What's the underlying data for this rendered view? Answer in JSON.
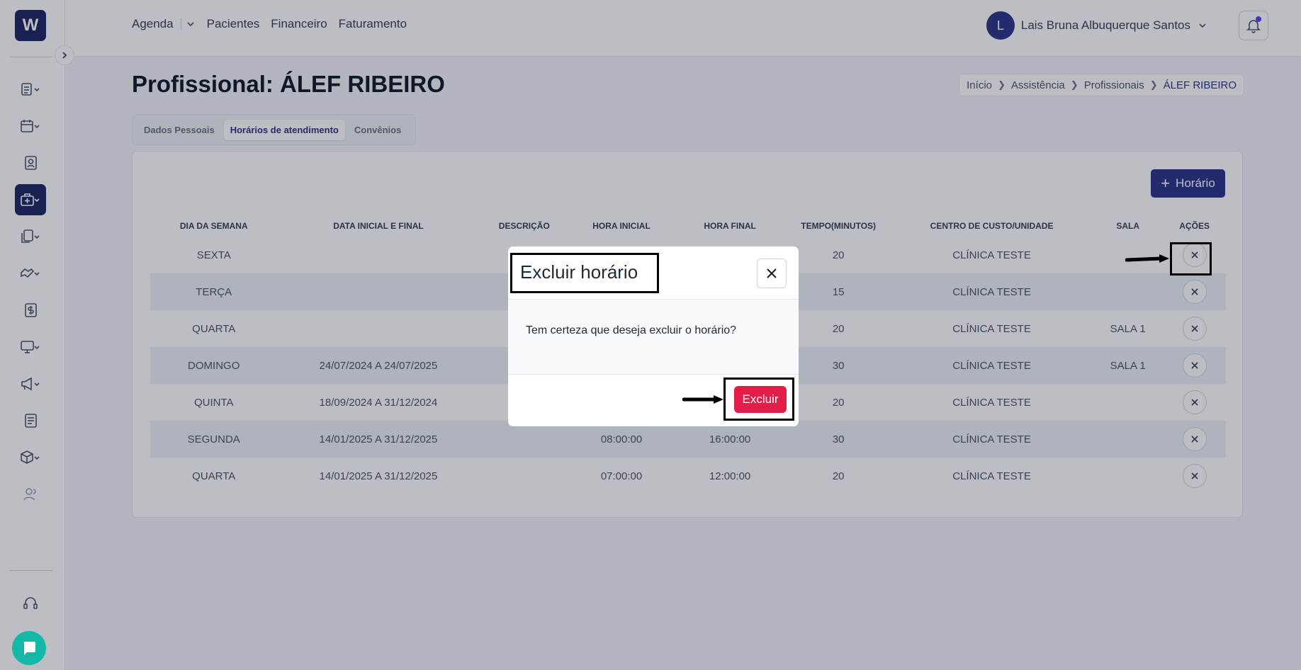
{
  "header": {
    "logo_text": "W",
    "nav": [
      {
        "label": "Agenda"
      },
      {
        "label": "Pacientes"
      },
      {
        "label": "Financeiro"
      },
      {
        "label": "Faturamento"
      }
    ],
    "user": {
      "initial": "L",
      "name": "Lais Bruna Albuquerque Santos"
    },
    "notification_dot_color": "#4f46e5"
  },
  "sidebar": {
    "items": [
      {
        "icon": "list-icon"
      },
      {
        "icon": "calendar-icon"
      },
      {
        "icon": "contact-icon"
      },
      {
        "icon": "medical-briefcase-icon",
        "active": true
      },
      {
        "icon": "documents-icon"
      },
      {
        "icon": "handshake-icon"
      },
      {
        "icon": "dollar-icon"
      },
      {
        "icon": "monitor-icon"
      },
      {
        "icon": "megaphone-icon"
      },
      {
        "icon": "reports-icon"
      },
      {
        "icon": "package-icon"
      },
      {
        "icon": "users-icon"
      }
    ],
    "support_icon": "headset-icon"
  },
  "page": {
    "title": "Profissional: ÁLEF RIBEIRO",
    "breadcrumb": [
      "Início",
      "Assistência",
      "Profissionais",
      "ÁLEF RIBEIRO"
    ],
    "tabs": [
      {
        "label": "Dados Pessoais",
        "active": false
      },
      {
        "label": "Horários de atendimento",
        "active": true
      },
      {
        "label": "Convênios",
        "active": false
      }
    ],
    "add_button": "Horário"
  },
  "table": {
    "columns": [
      "DIA DA SEMANA",
      "DATA INICIAL E FINAL",
      "DESCRIÇÃO",
      "HORA INICIAL",
      "HORA FINAL",
      "TEMPO(MINUTOS)",
      "CENTRO DE CUSTO/UNIDADE",
      "SALA",
      "AÇÕES"
    ],
    "rows": [
      {
        "dia": "SEXTA",
        "datas": "",
        "descricao": "",
        "hora_inicial": "",
        "hora_final": "",
        "tempo": "20",
        "centro": "CLÍNICA TESTE",
        "sala": ""
      },
      {
        "dia": "TERÇA",
        "datas": "",
        "descricao": "",
        "hora_inicial": "",
        "hora_final": "",
        "tempo": "15",
        "centro": "CLÍNICA TESTE",
        "sala": ""
      },
      {
        "dia": "QUARTA",
        "datas": "",
        "descricao": "",
        "hora_inicial": "",
        "hora_final": "",
        "tempo": "20",
        "centro": "CLÍNICA TESTE",
        "sala": "SALA 1"
      },
      {
        "dia": "DOMINGO",
        "datas": "24/07/2024 A 24/07/2025",
        "descricao": "",
        "hora_inicial": "",
        "hora_final": "",
        "tempo": "30",
        "centro": "CLÍNICA TESTE",
        "sala": "SALA 1"
      },
      {
        "dia": "QUINTA",
        "datas": "18/09/2024 A 31/12/2024",
        "descricao": "",
        "hora_inicial": "",
        "hora_final": "",
        "tempo": "20",
        "centro": "CLÍNICA TESTE",
        "sala": ""
      },
      {
        "dia": "SEGUNDA",
        "datas": "14/01/2025 A 31/12/2025",
        "descricao": "",
        "hora_inicial": "08:00:00",
        "hora_final": "16:00:00",
        "tempo": "30",
        "centro": "CLÍNICA TESTE",
        "sala": ""
      },
      {
        "dia": "QUARTA",
        "datas": "14/01/2025 A 31/12/2025",
        "descricao": "",
        "hora_inicial": "07:00:00",
        "hora_final": "12:00:00",
        "tempo": "20",
        "centro": "CLÍNICA TESTE",
        "sala": ""
      }
    ]
  },
  "modal": {
    "title": "Excluir horário",
    "message": "Tem certeza que deseja excluir o horário?",
    "confirm_label": "Excluir"
  },
  "colors": {
    "brand": "#2c3485",
    "danger": "#e11d48",
    "chat": "#14b8a6"
  }
}
